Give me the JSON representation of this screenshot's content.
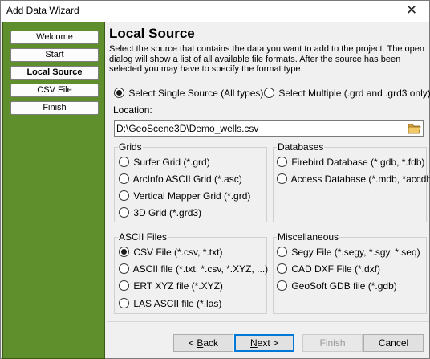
{
  "window": {
    "title": "Add Data Wizard",
    "close_glyph": "✕"
  },
  "sidebar": {
    "steps": [
      {
        "label": "Welcome"
      },
      {
        "label": "Start"
      },
      {
        "label": "Local Source"
      },
      {
        "label": "CSV File"
      },
      {
        "label": "Finish"
      }
    ],
    "active_step": "Local Source"
  },
  "page": {
    "heading": "Local Source",
    "description": "Select the source that contains the data you want to add to the project.  The open dialog will show a list of all available file formats. After the source has been selected you may have to specify the format type."
  },
  "source_mode": {
    "single": "Select Single Source (All types)",
    "multiple": "Select Multiple (.grd and .grd3 only)",
    "selected": "single"
  },
  "location": {
    "label": "Location:",
    "value": "D:\\GeoScene3D\\Demo_wells.csv"
  },
  "groups": {
    "grids": {
      "title": "Grids",
      "options": [
        "Surfer Grid (*.grd)",
        "ArcInfo ASCII Grid (*.asc)",
        "Vertical Mapper Grid (*.grd)",
        "3D Grid (*.grd3)"
      ]
    },
    "databases": {
      "title": "Databases",
      "options": [
        "Firebird Database (*.gdb, *.fdb)",
        "Access Database (*.mdb, *accdb)"
      ]
    },
    "ascii": {
      "title": "ASCII Files",
      "options": [
        "CSV File (*.csv, *.txt)",
        "ASCII file (*.txt, *.csv, *.XYZ, ...)",
        "ERT XYZ file (*.XYZ)",
        "LAS ASCII file (*.las)"
      ],
      "selected_index": 0
    },
    "misc": {
      "title": "Miscellaneous",
      "options": [
        "Segy File (*.segy, *.sgy, *.seq)",
        "CAD DXF File (*.dxf)",
        "GeoSoft GDB file (*.gdb)"
      ]
    }
  },
  "buttons": {
    "back_prefix": "< ",
    "back_hotkey": "B",
    "back_rest": "ack",
    "next_hotkey": "N",
    "next_rest": "ext >",
    "finish": "Finish",
    "cancel": "Cancel"
  },
  "colors": {
    "sidebar_green": "#5f8f2c",
    "focus_blue": "#0078d7"
  },
  "icons": {
    "folder": "folder-open-icon"
  }
}
